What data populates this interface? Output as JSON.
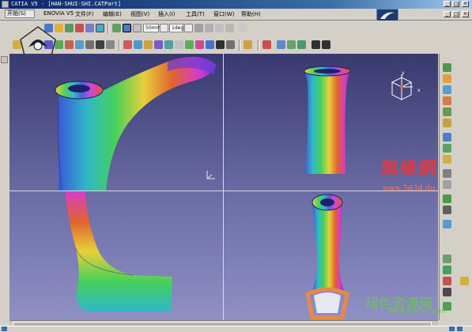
{
  "window": {
    "title": "CATIA V5 - [HAN-SHUI-SHI.CATPart]"
  },
  "menu": {
    "start": "开始(S)",
    "items": [
      "ENOVIA V5",
      "文件(F)",
      "编辑(E)",
      "视图(V)",
      "插入(I)",
      "工具(T)",
      "窗口(W)",
      "帮助(H)"
    ]
  },
  "toolbar": {
    "combo1": "50mm",
    "combo2": "1deg"
  },
  "viewport": {
    "layout": "4 split views",
    "background_top": "#38396e",
    "background_bottom": "#8f90c4",
    "compass_axes": [
      "y",
      "x",
      "z"
    ]
  },
  "watermarks": {
    "top_text": "無維網",
    "top_url": "www.5d3d.du",
    "bottom_text": "绿色资源网",
    "bottom_url": "www.downcc.com"
  }
}
